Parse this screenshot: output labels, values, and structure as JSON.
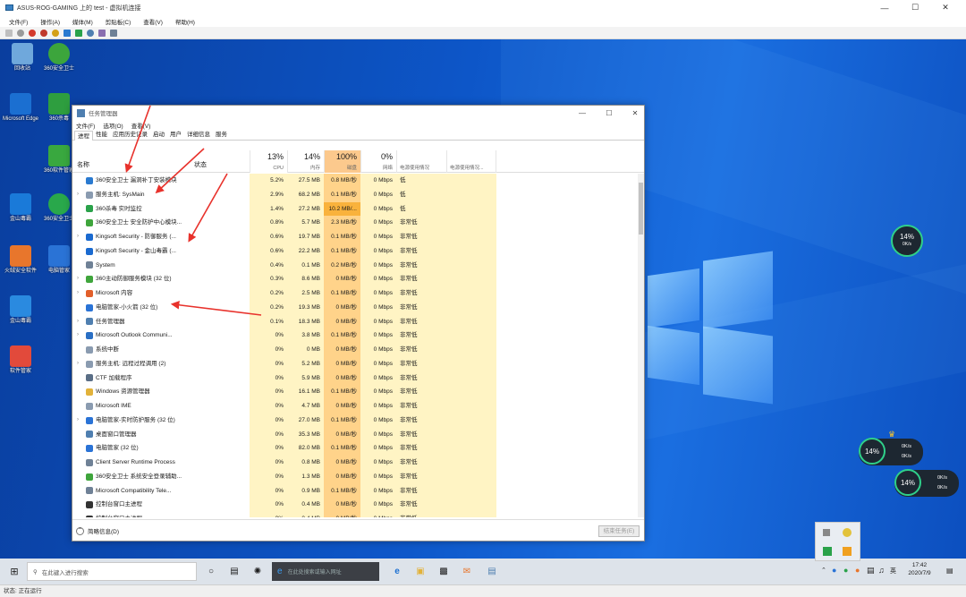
{
  "vm": {
    "title": "ASUS-ROG-GAMING 上的 test - 虚拟机连接",
    "menu": [
      "文件(F)",
      "操作(A)",
      "媒体(M)",
      "剪贴板(C)",
      "查看(V)",
      "帮助(H)"
    ],
    "status": "状态: 正在运行"
  },
  "desktop_icons": [
    {
      "label": "回收站",
      "color": "#6fa8dc"
    },
    {
      "label": "360安全卫士",
      "color": "#3ca53c"
    },
    {
      "label": "Microsoft Edge",
      "color": "#1b6fd1"
    },
    {
      "label": "360杀毒",
      "color": "#2e9e3f"
    },
    {
      "label": "360软件管家",
      "color": "#39a83f"
    },
    {
      "label": "金山毒霸",
      "color": "#1a7ad9"
    },
    {
      "label": "360安全卫士",
      "color": "#29a84b"
    },
    {
      "label": "火绒安全软件",
      "color": "#e8762c"
    },
    {
      "label": "电脑管家",
      "color": "#2a73d6"
    },
    {
      "label": "金山毒霸",
      "color": "#2a8ae0"
    },
    {
      "label": "软件管家",
      "color": "#e24a3b"
    }
  ],
  "task_manager": {
    "title": "任务管理器",
    "menu": [
      "文件(F)",
      "选项(O)",
      "查看(V)"
    ],
    "tabs": [
      "进程",
      "性能",
      "应用历史记录",
      "启动",
      "用户",
      "详细信息",
      "服务"
    ],
    "columns": {
      "name": "名称",
      "status": "状态",
      "cpu_pct": "13%",
      "cpu": "CPU",
      "mem_pct": "14%",
      "mem": "内存",
      "disk_pct": "100%",
      "disk": "磁盘",
      "net_pct": "0%",
      "net": "网络",
      "power": "电源使用情况",
      "power_trend": "电源使用情况..."
    },
    "processes": [
      {
        "name": "360安全卫士 漏洞补丁安装模块",
        "expand": false,
        "icon": "#2a7ad0",
        "cpu": "5.2%",
        "mem": "27.5 MB",
        "disk": "0.8 MB/秒",
        "net": "0 Mbps",
        "power": "低"
      },
      {
        "name": "服务主机: SysMain",
        "expand": true,
        "icon": "#8a9bb0",
        "cpu": "2.9%",
        "mem": "68.2 MB",
        "disk": "0.1 MB/秒",
        "net": "0 Mbps",
        "power": "低"
      },
      {
        "name": "360杀毒 实时监控",
        "expand": false,
        "icon": "#2aa24a",
        "cpu": "1.4%",
        "mem": "27.2 MB",
        "disk": "10.2 MB/...",
        "net": "0 Mbps",
        "power": "低"
      },
      {
        "name": "360安全卫士 安全防护中心模块...",
        "expand": false,
        "icon": "#3fa53c",
        "cpu": "0.8%",
        "mem": "5.7 MB",
        "disk": "2.3 MB/秒",
        "net": "0 Mbps",
        "power": "非常低"
      },
      {
        "name": "Kingsoft Security - 防御服务 (...",
        "expand": true,
        "icon": "#1a6ad0",
        "cpu": "0.6%",
        "mem": "19.7 MB",
        "disk": "0.1 MB/秒",
        "net": "0 Mbps",
        "power": "非常低"
      },
      {
        "name": "Kingsoft Security - 金山毒霸 (...",
        "expand": false,
        "icon": "#1a6ad0",
        "cpu": "0.6%",
        "mem": "22.2 MB",
        "disk": "0.1 MB/秒",
        "net": "0 Mbps",
        "power": "非常低"
      },
      {
        "name": "System",
        "expand": false,
        "icon": "#6f8196",
        "cpu": "0.4%",
        "mem": "0.1 MB",
        "disk": "0.2 MB/秒",
        "net": "0 Mbps",
        "power": "非常低"
      },
      {
        "name": "360主动防御服务模块 (32 位)",
        "expand": true,
        "icon": "#3fa53c",
        "cpu": "0.3%",
        "mem": "8.6 MB",
        "disk": "0 MB/秒",
        "net": "0 Mbps",
        "power": "非常低"
      },
      {
        "name": "Microsoft 内容",
        "expand": true,
        "icon": "#e25f2a",
        "cpu": "0.2%",
        "mem": "2.5 MB",
        "disk": "0.1 MB/秒",
        "net": "0 Mbps",
        "power": "非常低"
      },
      {
        "name": "电脑管家-小火箭 (32 位)",
        "expand": false,
        "icon": "#2a73d6",
        "cpu": "0.2%",
        "mem": "19.3 MB",
        "disk": "0 MB/秒",
        "net": "0 Mbps",
        "power": "非常低"
      },
      {
        "name": "任务管理器",
        "expand": true,
        "icon": "#4f7fb0",
        "cpu": "0.1%",
        "mem": "18.3 MB",
        "disk": "0 MB/秒",
        "net": "0 Mbps",
        "power": "非常低"
      },
      {
        "name": "Microsoft Outlook Communi...",
        "expand": true,
        "icon": "#2a6fc4",
        "cpu": "0%",
        "mem": "3.8 MB",
        "disk": "0.1 MB/秒",
        "net": "0 Mbps",
        "power": "非常低"
      },
      {
        "name": "系统中断",
        "expand": false,
        "icon": "#8a9bb0",
        "cpu": "0%",
        "mem": "0 MB",
        "disk": "0 MB/秒",
        "net": "0 Mbps",
        "power": "非常低"
      },
      {
        "name": "服务主机: 远程过程调用 (2)",
        "expand": true,
        "icon": "#8a9bb0",
        "cpu": "0%",
        "mem": "5.2 MB",
        "disk": "0 MB/秒",
        "net": "0 Mbps",
        "power": "非常低"
      },
      {
        "name": "CTF 加载程序",
        "expand": false,
        "icon": "#5a6e86",
        "cpu": "0%",
        "mem": "5.9 MB",
        "disk": "0 MB/秒",
        "net": "0 Mbps",
        "power": "非常低"
      },
      {
        "name": "Windows 资源管理器",
        "expand": false,
        "icon": "#e2b23a",
        "cpu": "0%",
        "mem": "16.1 MB",
        "disk": "0.1 MB/秒",
        "net": "0 Mbps",
        "power": "非常低"
      },
      {
        "name": "Microsoft IME",
        "expand": false,
        "icon": "#8a9bb0",
        "cpu": "0%",
        "mem": "4.7 MB",
        "disk": "0 MB/秒",
        "net": "0 Mbps",
        "power": "非常低"
      },
      {
        "name": "电脑管家-实时防护服务 (32 位)",
        "expand": true,
        "icon": "#2a73d6",
        "cpu": "0%",
        "mem": "27.0 MB",
        "disk": "0.1 MB/秒",
        "net": "0 Mbps",
        "power": "非常低"
      },
      {
        "name": "桌面窗口管理器",
        "expand": false,
        "icon": "#4f7fb0",
        "cpu": "0%",
        "mem": "35.3 MB",
        "disk": "0 MB/秒",
        "net": "0 Mbps",
        "power": "非常低"
      },
      {
        "name": "电脑管家 (32 位)",
        "expand": false,
        "icon": "#2a73d6",
        "cpu": "0%",
        "mem": "82.0 MB",
        "disk": "0.1 MB/秒",
        "net": "0 Mbps",
        "power": "非常低"
      },
      {
        "name": "Client Server Runtime Process",
        "expand": false,
        "icon": "#6f8196",
        "cpu": "0%",
        "mem": "0.8 MB",
        "disk": "0 MB/秒",
        "net": "0 Mbps",
        "power": "非常低"
      },
      {
        "name": "360安全卫士 系统安全登录辅助...",
        "expand": false,
        "icon": "#3fa53c",
        "cpu": "0%",
        "mem": "1.3 MB",
        "disk": "0 MB/秒",
        "net": "0 Mbps",
        "power": "非常低"
      },
      {
        "name": "Microsoft Compatibility Tele...",
        "expand": false,
        "icon": "#6f8196",
        "cpu": "0%",
        "mem": "0.9 MB",
        "disk": "0.1 MB/秒",
        "net": "0 Mbps",
        "power": "非常低"
      },
      {
        "name": "控制台窗口主进程",
        "expand": false,
        "icon": "#333333",
        "cpu": "0%",
        "mem": "0.4 MB",
        "disk": "0 MB/秒",
        "net": "0 Mbps",
        "power": "非常低"
      },
      {
        "name": "控制台窗口主进程",
        "expand": false,
        "icon": "#333333",
        "cpu": "0%",
        "mem": "0.4 MB",
        "disk": "0 MB/秒",
        "net": "0 Mbps",
        "power": "非常低"
      }
    ],
    "footer": {
      "less_details": "简略信息(D)",
      "end_task": "结束任务(E)"
    }
  },
  "widgets": {
    "gauge_a": "14%",
    "rate_a": "0K/s",
    "gauge_b": "14%",
    "rate_b1": "0K/s",
    "rate_b2": "0K/s",
    "gauge_c": "14%",
    "rate_c1": "0K/s",
    "rate_c2": "0K/s"
  },
  "taskbar": {
    "search_placeholder": "在此键入进行搜索",
    "edge_prompt": "在此处搜索或输入网址",
    "ime": "英",
    "time": "17:42",
    "date": "2020/7/9"
  },
  "colors": {
    "cpu_col": "#fff4c4",
    "disk_col": "#ffd38a",
    "disk_highlight": "#f9b23c",
    "header_disk": "#fcc98d",
    "arrow": "#e8322c"
  }
}
